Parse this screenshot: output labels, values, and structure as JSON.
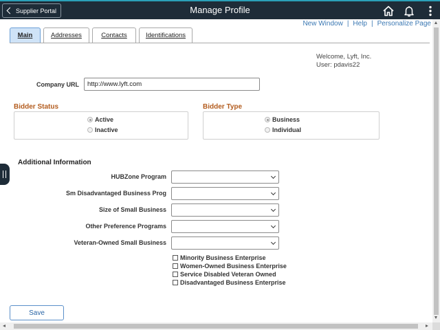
{
  "header": {
    "back_label": "Supplier Portal",
    "title": "Manage Profile",
    "icons": [
      "home-icon",
      "bell-icon",
      "kebab-menu-icon"
    ],
    "bar_color": "#1e2c38",
    "accent_color": "#2aa0b8"
  },
  "top_links": {
    "new_window": "New Window",
    "sep1": "|",
    "help": "Help",
    "sep2": "|",
    "personalize": "Personalize Page"
  },
  "tabs": [
    {
      "label": "Main",
      "active": true
    },
    {
      "label": "Addresses",
      "active": false
    },
    {
      "label": "Contacts",
      "active": false
    },
    {
      "label": "Identifications",
      "active": false
    }
  ],
  "welcome": {
    "line1": "Welcome, Lyft, Inc.",
    "line2": "User: pdavis22"
  },
  "company_url": {
    "label": "Company URL",
    "value": "http://www.lyft.com"
  },
  "bidder_status": {
    "title": "Bidder Status",
    "options": [
      {
        "label": "Active",
        "checked": true
      },
      {
        "label": "Inactive",
        "checked": false
      }
    ]
  },
  "bidder_type": {
    "title": "Bidder Type",
    "options": [
      {
        "label": "Business",
        "checked": true
      },
      {
        "label": "Individual",
        "checked": false
      }
    ]
  },
  "additional_info": {
    "title": "Additional Information",
    "selects": [
      {
        "label": "HUBZone Program",
        "value": ""
      },
      {
        "label": "Sm Disadvantaged Business Prog",
        "value": ""
      },
      {
        "label": "Size of Small Business",
        "value": ""
      },
      {
        "label": "Other Preference Programs",
        "value": ""
      },
      {
        "label": "Veteran-Owned Small Business",
        "value": ""
      }
    ],
    "checkboxes": [
      {
        "label": "Minority Business Enterprise",
        "checked": false
      },
      {
        "label": "Women-Owned Business Enterprise",
        "checked": false
      },
      {
        "label": "Service Disabled Veteran Owned",
        "checked": false
      },
      {
        "label": "Disadvantaged Business Enterprise",
        "checked": false
      }
    ]
  },
  "save_label": "Save",
  "colors": {
    "link": "#3b78b3",
    "section_title": "#b35c1e",
    "active_tab": "#cfe3f7"
  }
}
